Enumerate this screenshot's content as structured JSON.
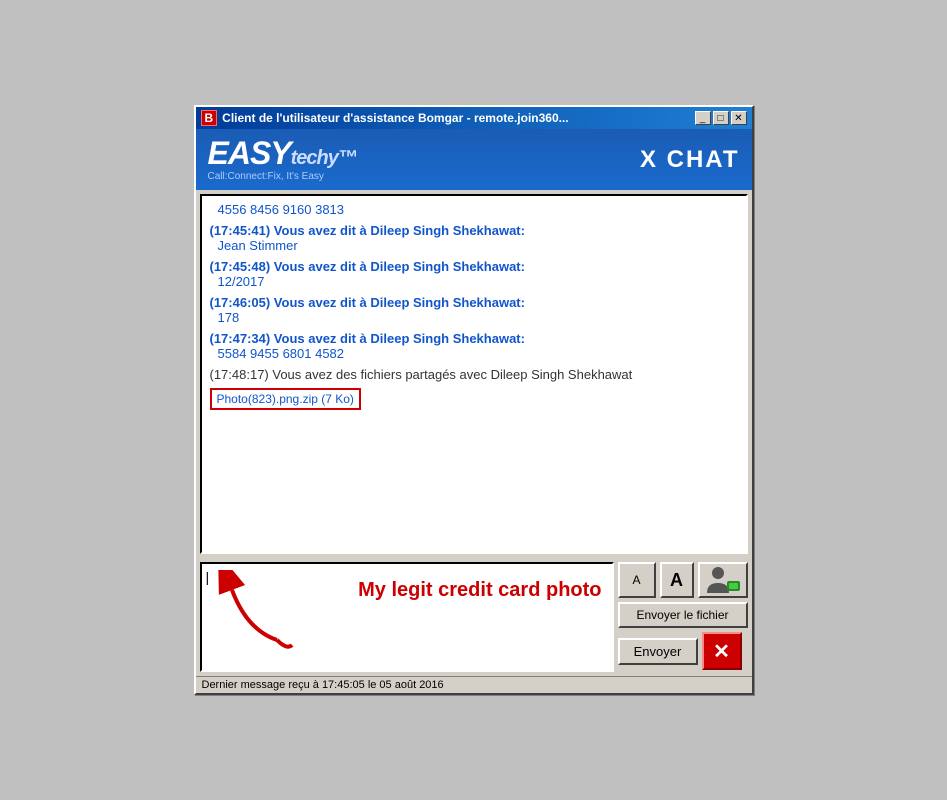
{
  "window": {
    "title": "Client de l'utilisateur d'assistance Bomgar - remote.join360...",
    "icon_label": "B"
  },
  "header": {
    "brand_easy": "EASY",
    "brand_techy": "techy™",
    "tagline": "Call:Connect:Fix, It's Easy",
    "chat_label": "X CHAT"
  },
  "chat": {
    "messages": [
      {
        "type": "body",
        "text": "4556 8456 9160 3813"
      },
      {
        "type": "header",
        "text": "(17:45:41) Vous avez dit à Dileep Singh Shekhawat:"
      },
      {
        "type": "body",
        "text": "Jean Stimmer"
      },
      {
        "type": "header",
        "text": "(17:45:48) Vous avez dit à Dileep Singh Shekhawat:"
      },
      {
        "type": "body",
        "text": "12/2017"
      },
      {
        "type": "header",
        "text": "(17:46:05) Vous avez dit à Dileep Singh Shekhawat:"
      },
      {
        "type": "body",
        "text": "178"
      },
      {
        "type": "header",
        "text": "(17:47:34) Vous avez dit à Dileep Singh Shekhawat:"
      },
      {
        "type": "body",
        "text": "5584 9455 6801 4582"
      },
      {
        "type": "system",
        "text": "(17:48:17) Vous avez des fichiers partagés avec Dileep Singh Shekhawat"
      },
      {
        "type": "file",
        "text": "Photo(823).png.zip (7 Ko)"
      }
    ]
  },
  "input": {
    "placeholder": "",
    "annotation": "My legit credit card photo"
  },
  "buttons": {
    "font_small_label": "A",
    "font_large_label": "A",
    "send_file_label": "Envoyer le fichier",
    "send_label": "Envoyer"
  },
  "status_bar": {
    "text": "Dernier message reçu à 17:45:05 le 05 août 2016"
  },
  "title_buttons": {
    "minimize": "_",
    "maximize": "□",
    "close": "✕"
  }
}
